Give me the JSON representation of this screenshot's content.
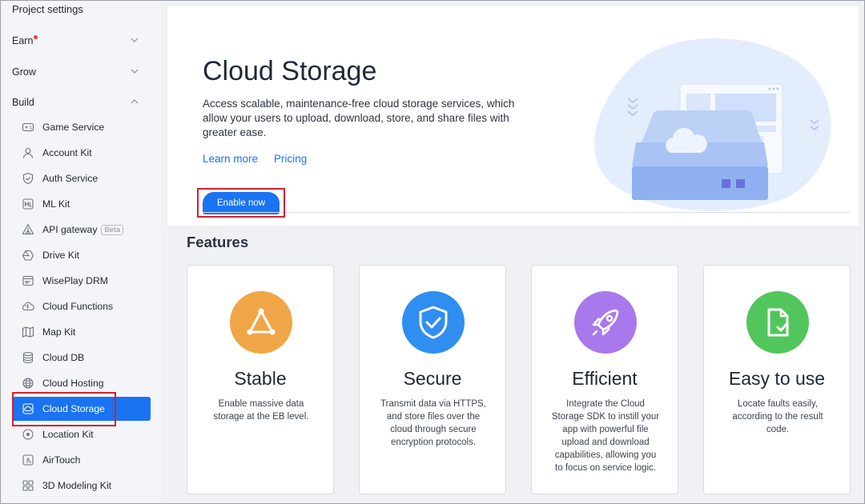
{
  "sidebar": {
    "top_label": "Project settings",
    "groups": [
      {
        "label": "Earn",
        "has_dot": true
      },
      {
        "label": "Grow"
      },
      {
        "label": "Build"
      }
    ],
    "items": [
      {
        "label": "Game Service",
        "icon": "gamepad-icon"
      },
      {
        "label": "Account Kit",
        "icon": "user-icon"
      },
      {
        "label": "Auth Service",
        "icon": "shield-check-icon"
      },
      {
        "label": "ML Kit",
        "icon": "ml-icon"
      },
      {
        "label": "API gateway",
        "icon": "gateway-icon",
        "badge": "Beta"
      },
      {
        "label": "Drive Kit",
        "icon": "drive-icon"
      },
      {
        "label": "WisePlay DRM",
        "icon": "drm-icon"
      },
      {
        "label": "Cloud Functions",
        "icon": "cloud-functions-icon"
      },
      {
        "label": "Map Kit",
        "icon": "map-icon"
      },
      {
        "label": "Cloud DB",
        "icon": "database-icon"
      },
      {
        "label": "Cloud Hosting",
        "icon": "globe-icon"
      },
      {
        "label": "Cloud Storage",
        "icon": "cloud-storage-icon",
        "active": true
      },
      {
        "label": "Location Kit",
        "icon": "location-icon"
      },
      {
        "label": "AirTouch",
        "icon": "airtouch-icon"
      },
      {
        "label": "3D Modeling Kit",
        "icon": "modeling-icon"
      }
    ]
  },
  "hero": {
    "title": "Cloud Storage",
    "description": "Access scalable, maintenance-free cloud storage services, which allow your users to upload, download, store, and share files with greater ease.",
    "learn_more": "Learn more",
    "pricing": "Pricing",
    "enable_button": "Enable now"
  },
  "features": {
    "title": "Features",
    "cards": [
      {
        "title": "Stable",
        "description": "Enable massive data storage at the EB level.",
        "color": "#f0a646",
        "icon": "triangle-network-icon"
      },
      {
        "title": "Secure",
        "description": "Transmit data via HTTPS, and store files over the cloud through secure encryption protocols.",
        "color": "#2f8ef0",
        "icon": "shield-check-icon"
      },
      {
        "title": "Efficient",
        "description": "Integrate the Cloud Storage SDK to instill your app with powerful file upload and download capabilities, allowing you to focus on service logic.",
        "color": "#a878ec",
        "icon": "rocket-icon"
      },
      {
        "title": "Easy to use",
        "description": "Locate faults easily, according to the result code.",
        "color": "#52c65c",
        "icon": "document-check-icon"
      }
    ]
  },
  "colors": {
    "accent": "#1a73f2",
    "highlight": "#d6202d",
    "notification_dot": "#ee3b43"
  }
}
